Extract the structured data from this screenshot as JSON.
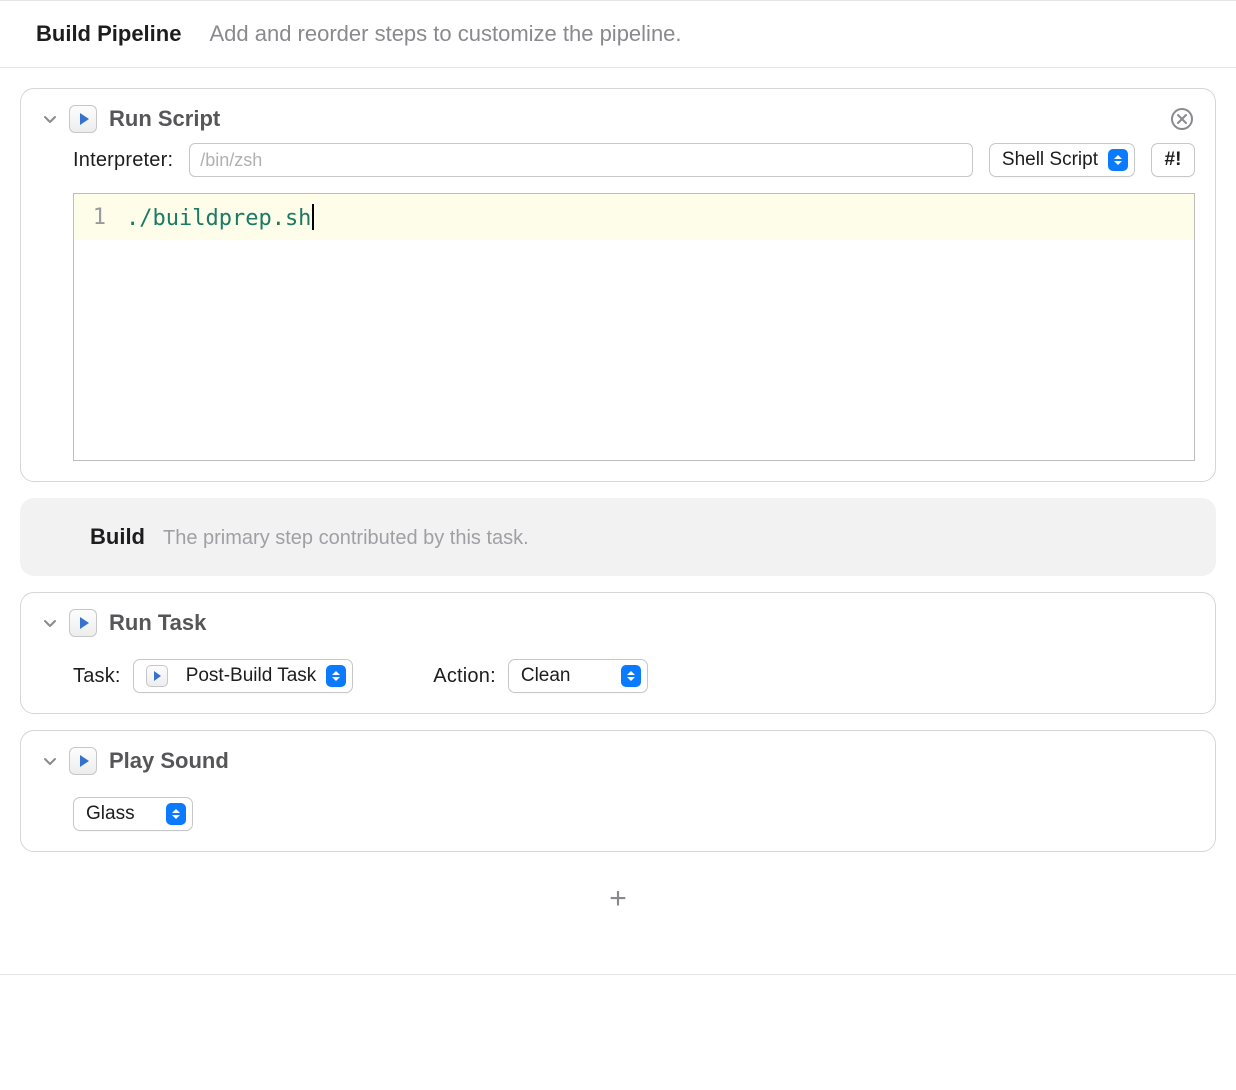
{
  "header": {
    "title": "Build Pipeline",
    "subtitle": "Add and reorder steps to customize the pipeline."
  },
  "runScript": {
    "title": "Run Script",
    "interpreterLabel": "Interpreter:",
    "interpreterPlaceholder": "/bin/zsh",
    "interpreterValue": "",
    "typeSelect": "Shell Script",
    "shebangButton": "#!",
    "lineNumber": "1",
    "code": "./buildprep.sh"
  },
  "buildStep": {
    "title": "Build",
    "subtitle": "The primary step contributed by this task."
  },
  "runTask": {
    "title": "Run Task",
    "taskLabel": "Task:",
    "taskSelect": "Post-Build Task",
    "actionLabel": "Action:",
    "actionSelect": "Clean"
  },
  "playSound": {
    "title": "Play Sound",
    "soundSelect": "Glass"
  },
  "addButton": "+"
}
